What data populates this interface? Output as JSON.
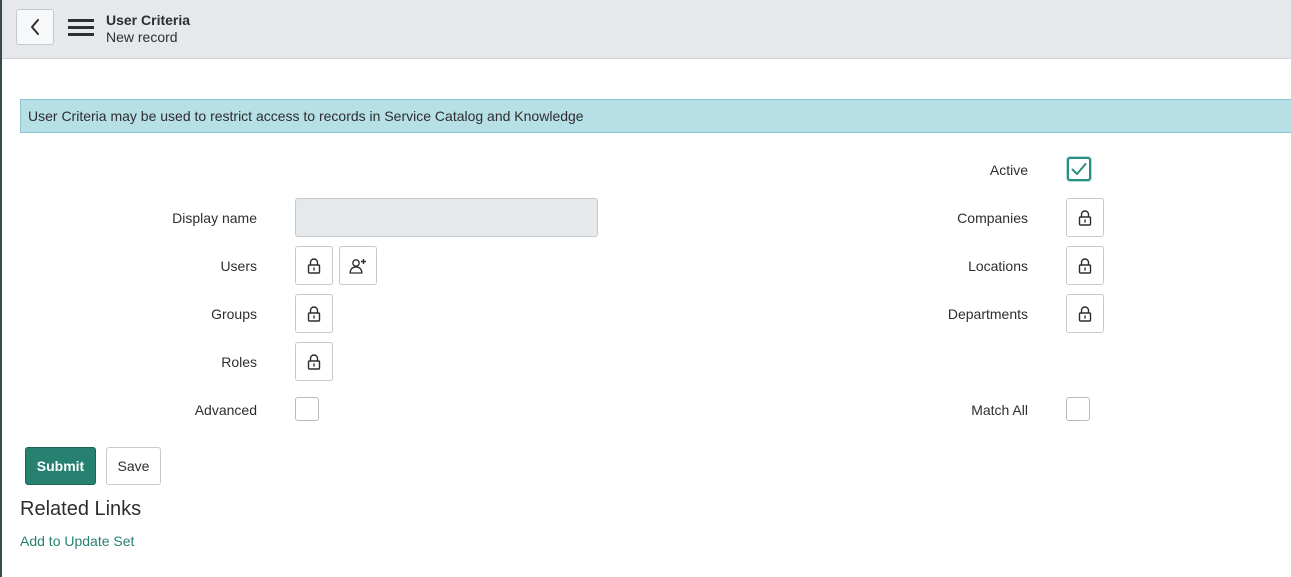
{
  "header": {
    "title": "User Criteria",
    "subtitle": "New record"
  },
  "banner": {
    "text": "User Criteria may be used to restrict access to records in Service Catalog and Knowledge"
  },
  "form": {
    "display_name": {
      "label": "Display name",
      "value": ""
    },
    "users": {
      "label": "Users"
    },
    "groups": {
      "label": "Groups"
    },
    "roles": {
      "label": "Roles"
    },
    "advanced": {
      "label": "Advanced",
      "checked": false
    },
    "active": {
      "label": "Active",
      "checked": true
    },
    "companies": {
      "label": "Companies"
    },
    "locations": {
      "label": "Locations"
    },
    "departments": {
      "label": "Departments"
    },
    "match_all": {
      "label": "Match All",
      "checked": false
    }
  },
  "actions": {
    "submit_label": "Submit",
    "save_label": "Save"
  },
  "related": {
    "heading": "Related Links",
    "links": [
      "Add to Update Set"
    ]
  },
  "colors": {
    "accent": "#278170",
    "banner_bg": "#b6dfe6",
    "header_bg": "#e6e9eb"
  },
  "icons": {
    "back": "chevron-left-icon",
    "menu": "hamburger-menu-icon",
    "lock": "lock-icon",
    "add_user": "add-user-icon",
    "check": "checkmark-icon"
  }
}
